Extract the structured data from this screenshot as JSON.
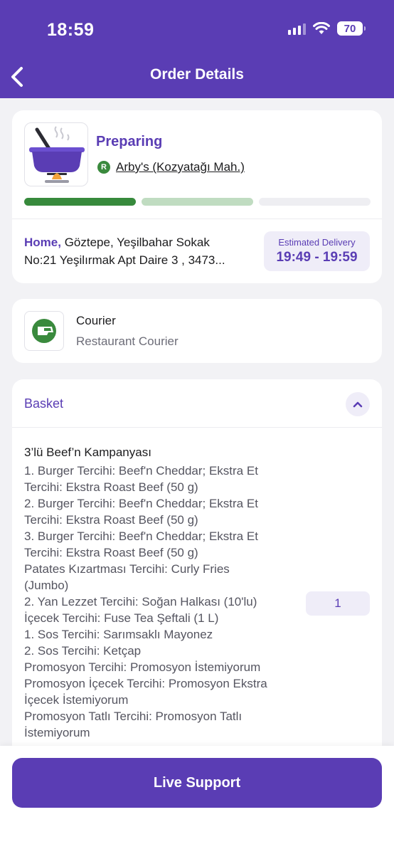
{
  "status_bar": {
    "time": "18:59",
    "battery": "70"
  },
  "header": {
    "title": "Order Details"
  },
  "order_status": {
    "state": "Preparing",
    "restaurant_badge": "R",
    "restaurant": "Arby's (Kozyatağı Mah.)",
    "progress_steps": [
      "completed",
      "in-progress",
      "pending"
    ],
    "progress_colors": [
      "#378a3c",
      "#c0dcc1",
      "#eeeef2"
    ]
  },
  "delivery": {
    "address_label": "Home,",
    "address_line1": "Göztepe, Yeşilbahar Sokak",
    "address_line2": "No:21 Yeşilırmak Apt Daire 3 , 3473...",
    "eta_label": "Estimated Delivery",
    "eta_value": "19:49 - 19:59"
  },
  "courier": {
    "title": "Courier",
    "subtitle": "Restaurant Courier"
  },
  "basket": {
    "title": "Basket",
    "items": [
      {
        "name": "3’lü Beef’n Kampanyası",
        "quantity": "1",
        "options": [
          "1. Burger Tercihi: Beef'n Cheddar; Ekstra Et",
          "Tercihi: Ekstra Roast Beef (50 g)",
          "2. Burger Tercihi: Beef'n Cheddar; Ekstra Et",
          "Tercihi: Ekstra Roast Beef (50 g)",
          "3. Burger Tercihi: Beef'n Cheddar; Ekstra Et",
          "Tercihi: Ekstra Roast Beef (50 g)",
          "Patates Kızartması Tercihi: Curly Fries",
          "(Jumbo)",
          "2. Yan Lezzet Tercihi: Soğan Halkası (10'lu)",
          "İçecek Tercihi: Fuse Tea Şeftali (1 L)",
          "1. Sos Tercihi: Sarımsaklı Mayonez",
          "2. Sos Tercihi: Ketçap",
          "Promosyon Tercihi: Promosyon İstemiyorum",
          "Promosyon İçecek Tercihi: Promosyon Ekstra",
          "İçecek İstemiyorum",
          "Promosyon Tatlı Tercihi: Promosyon Tatlı",
          "İstemiyorum"
        ]
      }
    ]
  },
  "footer": {
    "support_label": "Live Support"
  },
  "colors": {
    "brand": "#5a3db4",
    "accent_green": "#378a3c",
    "background": "#f2f2f5"
  }
}
